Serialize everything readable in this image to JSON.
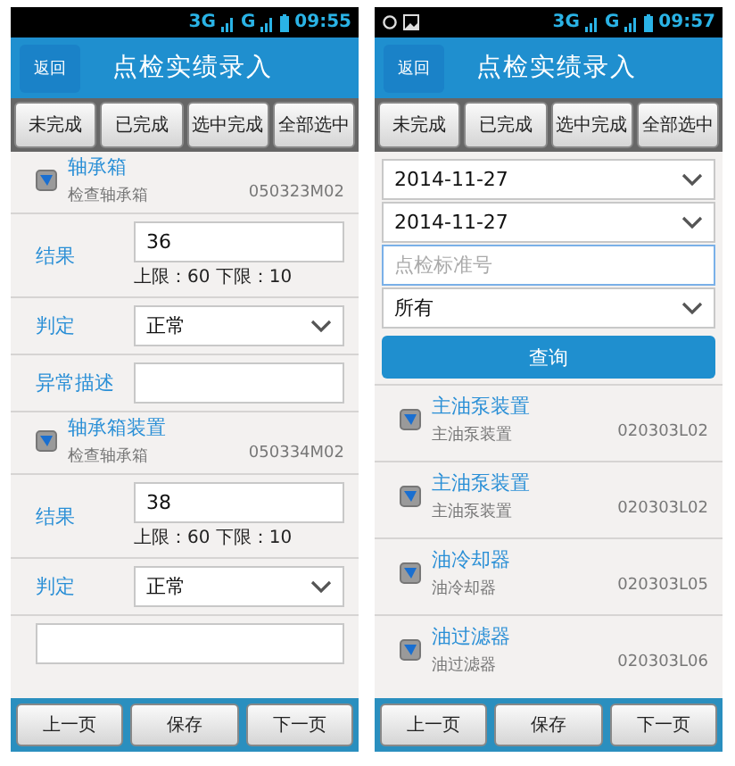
{
  "screens": [
    {
      "status": {
        "notification_icons": false,
        "network": "3G",
        "network2": "G",
        "time": "09:55"
      },
      "header": {
        "back": "返回",
        "title": "点检实绩录入"
      },
      "actions": [
        "未完成",
        "已完成",
        "选中完成",
        "全部选中"
      ],
      "content": {
        "kind": "entry",
        "items": [
          {
            "checked": true,
            "name": "轴承箱",
            "desc": "检查轴承箱",
            "code": "050323M02",
            "fields": [
              {
                "kind": "input",
                "label": "结果",
                "value": "36",
                "hint": "上限：60 下限：10"
              },
              {
                "kind": "select",
                "label": "判定",
                "value": "正常"
              },
              {
                "kind": "input",
                "label": "异常描述"
              }
            ]
          },
          {
            "checked": true,
            "name": "轴承箱装置",
            "desc": "检查轴承箱",
            "code": "050334M02",
            "fields": [
              {
                "kind": "input",
                "label": "结果",
                "value": "38",
                "hint": "上限：60 下限：10"
              },
              {
                "kind": "select",
                "label": "判定",
                "value": "正常"
              },
              {
                "kind": "input"
              }
            ]
          }
        ]
      },
      "footer": [
        "上一页",
        "保存",
        "下一页"
      ]
    },
    {
      "status": {
        "notification_icons": true,
        "network": "3G",
        "network2": "G",
        "time": "09:57"
      },
      "header": {
        "back": "返回",
        "title": "点检实绩录入"
      },
      "actions": [
        "未完成",
        "已完成",
        "选中完成",
        "全部选中"
      ],
      "content": {
        "kind": "query",
        "filters": [
          {
            "kind": "select",
            "value": "2014-11-27"
          },
          {
            "kind": "select",
            "value": "2014-11-27"
          },
          {
            "kind": "input",
            "placeholder": "点检标准号"
          },
          {
            "kind": "select",
            "value": "所有"
          }
        ],
        "button": "查询",
        "items": [
          {
            "checked": true,
            "name": "主油泵装置",
            "desc": "主油泵装置",
            "code": "020303L02"
          },
          {
            "checked": true,
            "name": "主油泵装置",
            "desc": "主油泵装置",
            "code": "020303L02"
          },
          {
            "checked": true,
            "name": "油冷却器",
            "desc": "油冷却器",
            "code": "020303L05"
          },
          {
            "checked": true,
            "name": "油过滤器",
            "desc": "油过滤器",
            "code": "020303L06"
          }
        ]
      },
      "footer": [
        "上一页",
        "保存",
        "下一页"
      ]
    }
  ]
}
